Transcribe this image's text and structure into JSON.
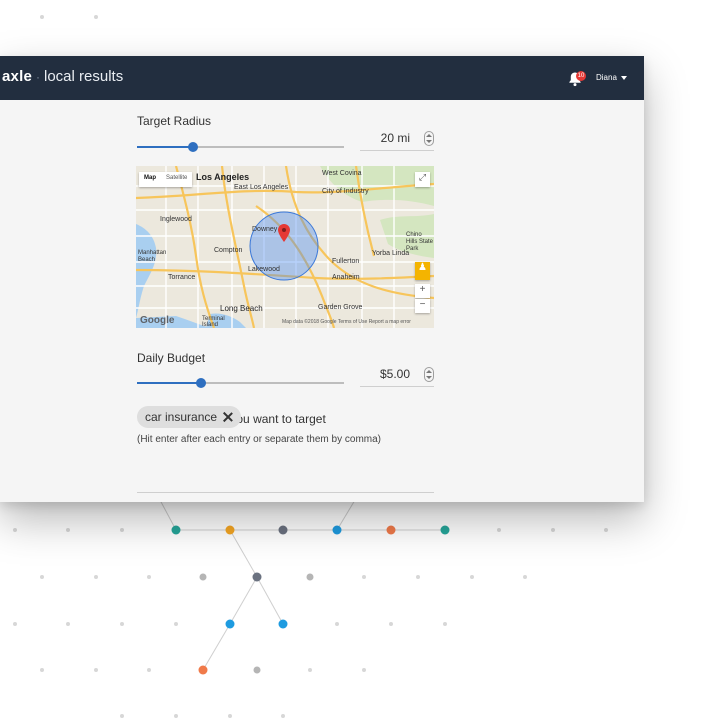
{
  "header": {
    "brand": "axle",
    "separator": "·",
    "section": "local results",
    "notification_count": "10",
    "user_name": "Diana"
  },
  "radius": {
    "label": "Target Radius",
    "value": "20 mi",
    "slider_level": 0.27
  },
  "map": {
    "type_map": "Map",
    "type_satellite": "Satellite",
    "zoom_in": "+",
    "zoom_out": "−",
    "google": "Google",
    "attribution": "Map data ©2018 Google   Terms of Use   Report a map error",
    "cities": {
      "west_covina": "West Covina",
      "los_angeles": "Los Angeles",
      "east_los_angeles": "East Los Angeles",
      "city_of_industry": "City of Industry",
      "inglewood": "Inglewood",
      "downey": "Downey",
      "chino_hills": "Chino Hills State Park",
      "manhattan_beach": "Manhattan Beach",
      "compton": "Compton",
      "fullerton": "Fullerton",
      "yorba_linda": "Yorba Linda",
      "torrance": "Torrance",
      "lakewood": "Lakewood",
      "anaheim": "Anaheim",
      "long_beach": "Long Beach",
      "garden_grove": "Garden Grove",
      "terminal_island": "Terminal Island"
    }
  },
  "budget": {
    "label": "Daily Budget",
    "value": "$5.00",
    "slider_level": 0.31
  },
  "interests": {
    "label": "Choose interests you want to target",
    "hint": "(Hit enter after each entry or separate them by comma)",
    "chips": [
      "car insurance"
    ]
  },
  "colors": {
    "topbar": "#222e3f",
    "accent": "#2e6fc0",
    "badge": "#e53935"
  }
}
